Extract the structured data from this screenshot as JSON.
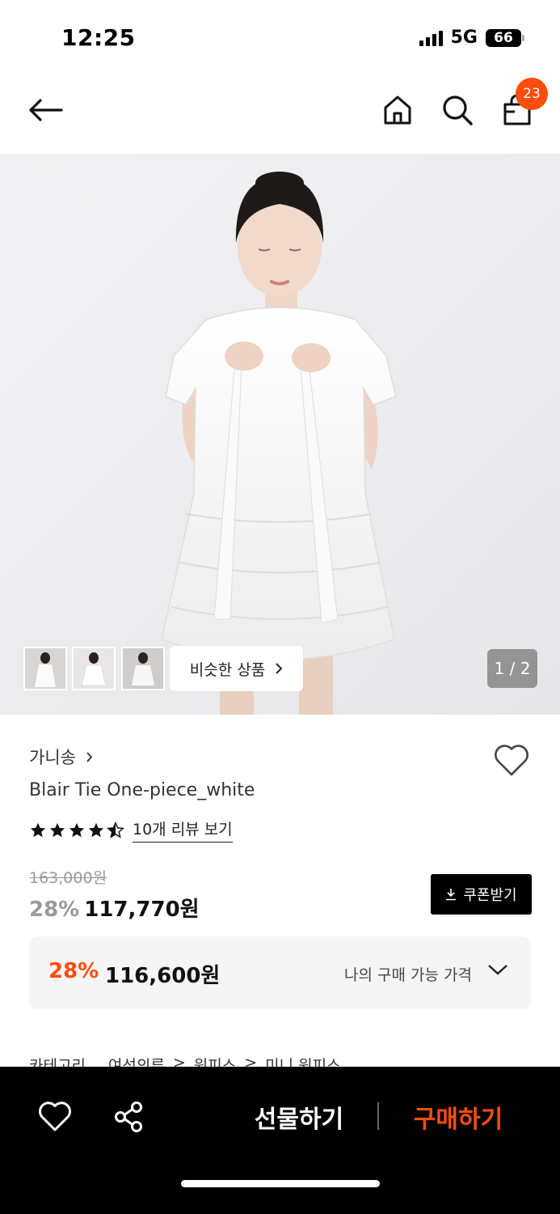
{
  "status": {
    "time": "12:25",
    "network": "5G",
    "battery": "66"
  },
  "header": {
    "cart_count": "23"
  },
  "gallery": {
    "similar_label": "비슷한 상품",
    "page_indicator": "1 / 2"
  },
  "product": {
    "brand": "가니송",
    "title": "Blair Tie One-piece_white",
    "rating": 4.5,
    "reviews_label": "10개 리뷰 보기",
    "original_price": "163,000원",
    "discount_pct": "28%",
    "sale_price": "117,770원",
    "coupon_label": "쿠폰받기"
  },
  "my_price": {
    "discount_pct": "28%",
    "price": "116,600원",
    "label": "나의 구매 가능 가격"
  },
  "category": {
    "label": "카테고리",
    "path": [
      "여성의류",
      "원피스",
      "미니 원피스"
    ]
  },
  "bottom_bar": {
    "gift_label": "선물하기",
    "buy_label": "구매하기"
  },
  "colors": {
    "accent": "#ff4c0f",
    "bar_bg": "#000000"
  }
}
